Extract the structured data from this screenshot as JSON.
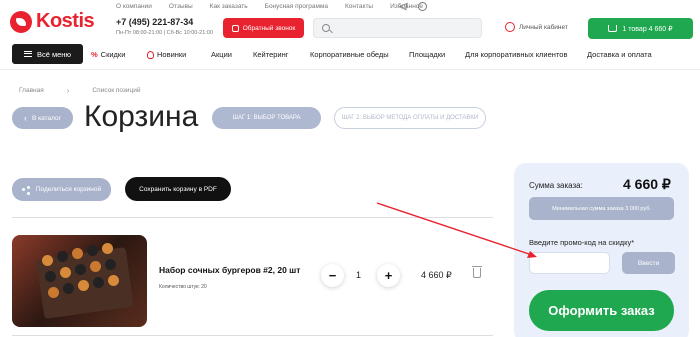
{
  "brand": {
    "name": "Kostis",
    "color": "#e8232f"
  },
  "topnav": [
    "О компании",
    "Отзывы",
    "Как заказать",
    "Бонусная программа",
    "Контакты",
    "Избранное"
  ],
  "contact": {
    "phone": "+7 (495) 221-87-34",
    "hours": "Пн-Пт 08:00-21:00  |  Сб-Вс 10:00-21:00"
  },
  "callback_label": "Обратный звонок",
  "account_label": "Личный кабинет",
  "cart_button": "1 товар 4 660 ₽",
  "mainnav": {
    "all_menu": "Всё меню",
    "items": [
      "Скидки",
      "Новинки",
      "Акции",
      "Кейтеринг",
      "Корпоративные обеды",
      "Площадки",
      "Для корпоративных клиентов",
      "Доставка и оплата"
    ]
  },
  "breadcrumb": [
    "Главная",
    "Список позиций"
  ],
  "back_label": "В каталог",
  "page_title": "Корзина",
  "steps": [
    "ШАГ 1: ВЫБОР ТОВАРА",
    "ШАГ 2: ВЫБОР МЕТОДА ОПЛАТЫ И ДОСТАВКИ"
  ],
  "share_label": "Поделиться корзиной",
  "pdf_label": "Сохранить корзину в PDF",
  "item": {
    "name": "Набор сочных бургеров #2, 20 шт",
    "qty_label": "Количество штук: 20",
    "quantity": "1",
    "price": "4 660 ₽"
  },
  "summary": {
    "sum_label": "Сумма заказа:",
    "sum_value": "4 660 ₽",
    "min_sum": "Минимальная сумма заказа 3 000 руб.",
    "promo_label": "Введите промо-код на скидку*",
    "promo_value": "",
    "apply_label": "Ввести",
    "checkout_label": "Оформить заказ"
  },
  "colors": {
    "green": "#1fa84f",
    "grey_button": "#a9b3cc",
    "panel": "#eaf0fb",
    "annotation_arrow": "#e8232f"
  }
}
